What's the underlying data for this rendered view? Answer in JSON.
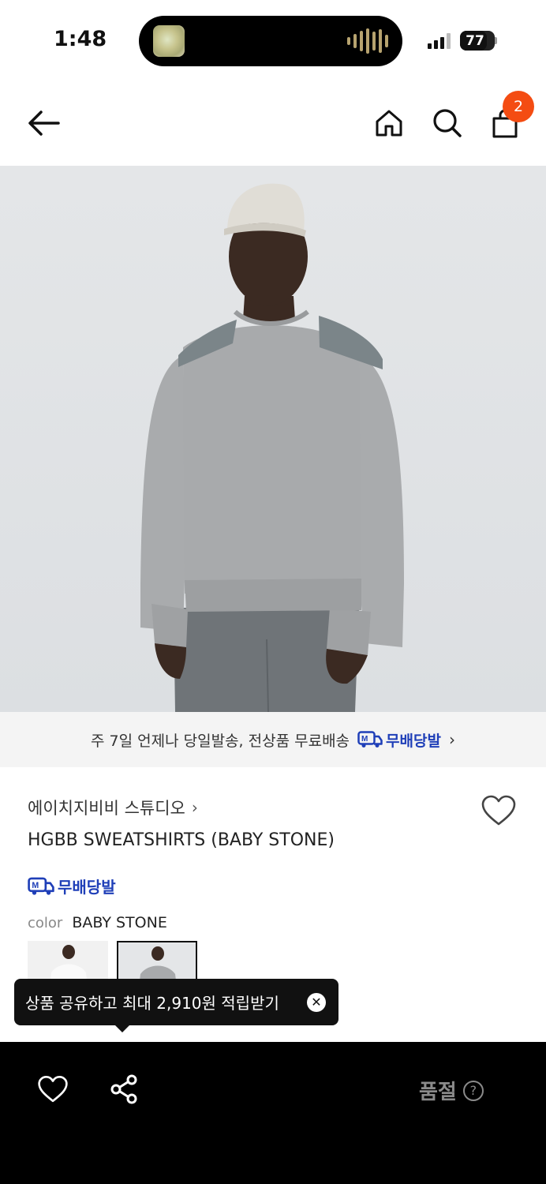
{
  "status_bar": {
    "time": "1:48",
    "battery": "77",
    "battery_level": 0.77
  },
  "nav": {
    "cart_count": "2"
  },
  "delivery_banner": {
    "text": "주 7일 언제나 당일발송, 전상품 무료배송",
    "badge": "무배당발",
    "chevron": "›"
  },
  "product": {
    "brand": "에이치지비비 스튜디오",
    "brand_chevron": "›",
    "name": "HGBB SWEATSHIRTS (BABY STONE)",
    "delivery_badge": "무배당발",
    "color_label": "color",
    "color_value": "BABY STONE"
  },
  "tooltip": {
    "text": "상품 공유하고 최대 2,910원 적립받기",
    "close": "✕"
  },
  "bottom_bar": {
    "status": "품절",
    "help": "?"
  },
  "icons": {
    "back": "arrow-left-icon",
    "home": "home-icon",
    "search": "search-icon",
    "cart": "shopping-bag-icon",
    "wishlist": "heart-icon",
    "share": "share-icon",
    "delivery": "delivery-truck-icon"
  },
  "colors": {
    "accent": "#f44c12",
    "delivery_blue": "#1f3fb8"
  }
}
